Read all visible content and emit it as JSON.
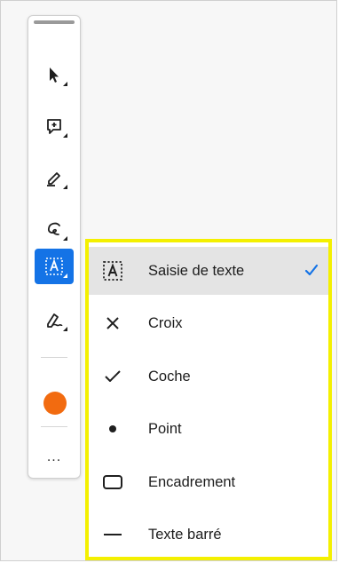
{
  "toolbar": {
    "tools": [
      {
        "name": "select-tool",
        "icon": "arrow-cursor-icon"
      },
      {
        "name": "comment-tool",
        "icon": "add-comment-icon"
      },
      {
        "name": "highlight-tool",
        "icon": "highlighter-icon"
      },
      {
        "name": "draw-tool",
        "icon": "freehand-draw-icon"
      },
      {
        "name": "text-field-tool",
        "icon": "text-field-icon",
        "active": true
      },
      {
        "name": "signature-tool",
        "icon": "sign-pen-icon"
      }
    ],
    "current_color": "#f26b10",
    "more_label": "..."
  },
  "menu": {
    "items": [
      {
        "label": "Saisie de texte",
        "icon": "text-field-icon",
        "selected": true
      },
      {
        "label": "Croix",
        "icon": "cross-icon"
      },
      {
        "label": "Coche",
        "icon": "checkmark-icon"
      },
      {
        "label": "Point",
        "icon": "dot-icon"
      },
      {
        "label": "Encadrement",
        "icon": "rounded-rectangle-icon"
      },
      {
        "label": "Texte barré",
        "icon": "strikethrough-line-icon"
      }
    ]
  },
  "colors": {
    "accent": "#1473e6",
    "highlight_border": "#f4f000",
    "selected_row": "#e4e4e4",
    "color_swatch": "#f26b10"
  }
}
